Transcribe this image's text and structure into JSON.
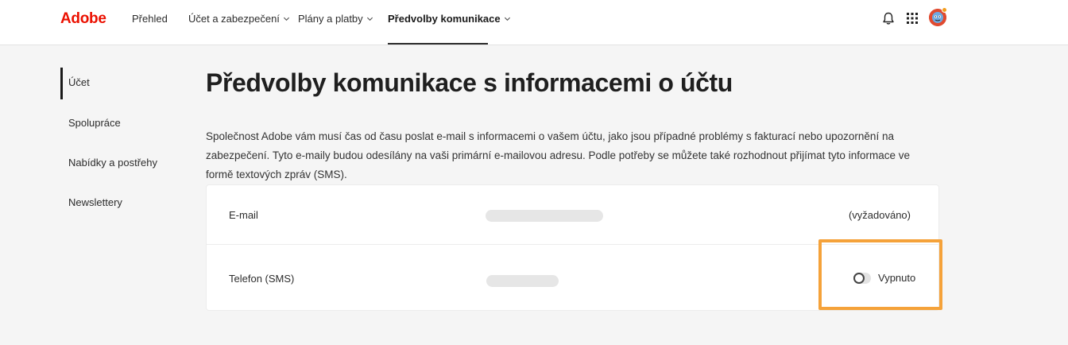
{
  "header": {
    "logo": "Adobe",
    "nav": [
      {
        "label": "Přehled"
      },
      {
        "label": "Účet a zabezpečení"
      },
      {
        "label": "Plány a platby"
      },
      {
        "label": "Předvolby komunikace"
      }
    ],
    "icons": [
      "bell-icon",
      "apps-grid-icon",
      "avatar"
    ],
    "accent_color": "#eb1000"
  },
  "sidebar": {
    "items": [
      {
        "label": "Účet",
        "active": true
      },
      {
        "label": "Spolupráce"
      },
      {
        "label": "Nabídky a postřehy"
      },
      {
        "label": "Newslettery"
      }
    ]
  },
  "main": {
    "title": "Předvolby komunikace s informacemi o účtu",
    "description": "Společnost Adobe vám musí čas od času poslat e-mail s informacemi o vašem účtu, jako jsou případné problémy s fakturací nebo upozornění na zabezpečení. Tyto e-maily budou odesílány na vaši primární e-mailovou adresu. Podle potřeby se můžete také rozhodnout přijímat tyto informace ve formě textových zpráv (SMS).",
    "rows": [
      {
        "label": "E-mail",
        "status": "(vyžadováno)"
      },
      {
        "label": "Telefon (SMS)",
        "toggle_label": "Vypnuto",
        "toggle_on": false
      }
    ],
    "highlight_color": "#f5a23a"
  }
}
